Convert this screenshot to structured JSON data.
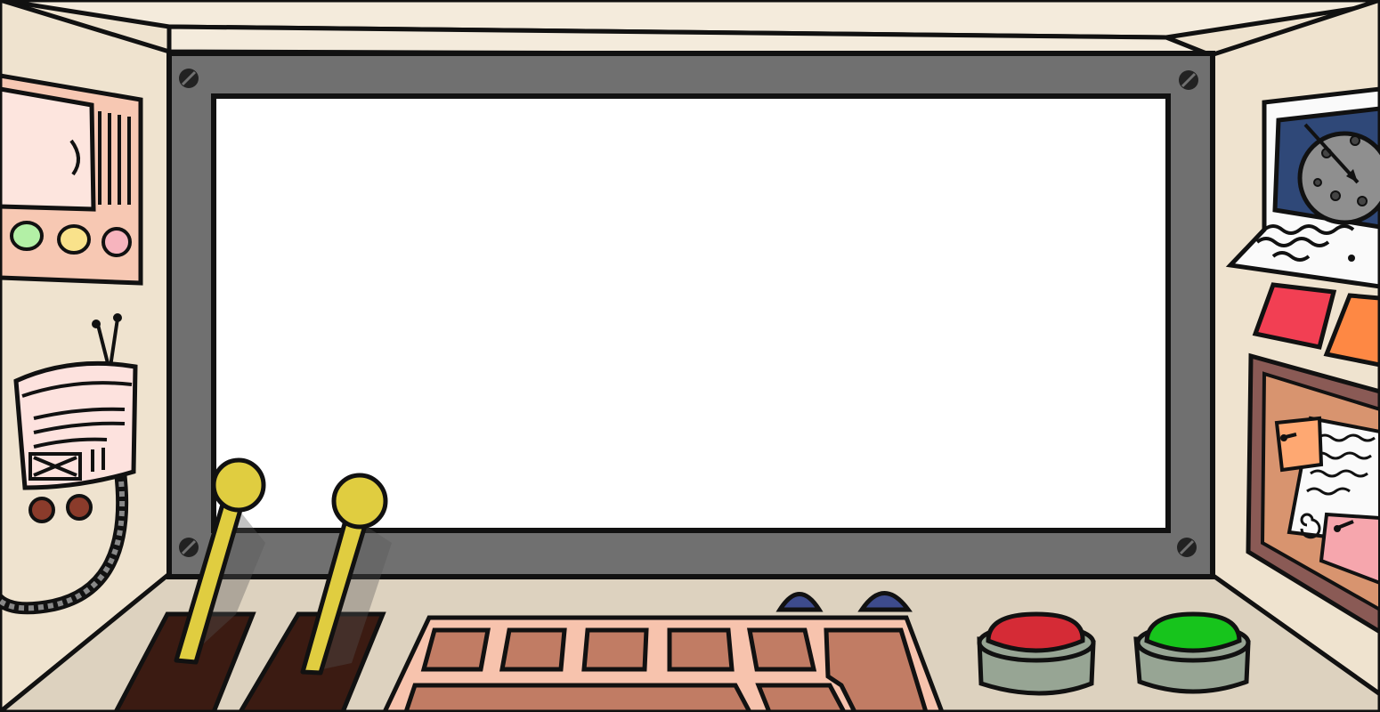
{
  "scene": {
    "wall_color": "#efe3cf",
    "ceiling_color": "#f4ebdc",
    "desk_color": "#ddd2bf",
    "outline_color": "#111111"
  },
  "viewscreen": {
    "frame_color": "#707070",
    "screen_color": "#ffffff"
  },
  "left_panel": {
    "panel_color": "#f7c8b3",
    "indicator_lights": [
      "#b3f0a6",
      "#f9e28b",
      "#f7b4be"
    ]
  },
  "radio": {
    "body_color": "#fde2de",
    "knob_colors": [
      "#8a3b2b",
      "#8a3b2b"
    ]
  },
  "levers": {
    "color": "#e0cd40",
    "count": 2
  },
  "dome_buttons": {
    "color": "#3d4b8c",
    "count": 2
  },
  "keypad": {
    "base_color": "#f7c3ad",
    "key_color": "#c17c64",
    "key_count": 7
  },
  "big_buttons": [
    {
      "name": "red-button",
      "color": "#d52b36"
    },
    {
      "name": "green-button",
      "color": "#17c41c"
    }
  ],
  "base_color": "#97a594",
  "right_panel": {
    "radar_bg": "#2f4878",
    "radar_planet": "#8f8f8f",
    "tab_colors": [
      "#f23f53",
      "#fe8844"
    ],
    "corkboard_color": "#d8946f",
    "frame_color": "#8a5a55",
    "sticky_notes": [
      "#fea872",
      "#f6a6ad"
    ]
  }
}
